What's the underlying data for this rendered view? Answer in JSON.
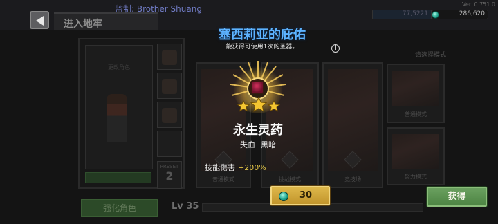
{
  "header": {
    "supervisor": "监制: Brother Shuang",
    "version": "Ver. 0.751.0",
    "dungeon_tab": "进入地牢",
    "currency_main": "286,620",
    "currency_dim": "77,5221"
  },
  "background": {
    "character_card_label": "更改角色",
    "preset_label": "PRESET",
    "preset_number": "2",
    "strengthen_button": "强化角色",
    "level": "Lv 35",
    "select_mode_label": "请选择模式",
    "mode_captions": [
      "普通模式",
      "挑战模式",
      "竞技场",
      "普通模式",
      "努力模式"
    ]
  },
  "modal": {
    "title": "塞西莉亚的庇佑",
    "subtitle": "能获得可使用1次的圣器。",
    "item_name": "永生灵药",
    "tags": [
      "失血",
      "黑暗"
    ],
    "effect_label": "技能傷害",
    "effect_value": "+200%",
    "stars": 3
  },
  "actions": {
    "cost_value": "30",
    "get_label": "获得"
  },
  "colors": {
    "title": "#5db3ff",
    "effect_value": "#e0c246",
    "get_button": "#5a9150",
    "cost_button": "#d2a73d"
  }
}
